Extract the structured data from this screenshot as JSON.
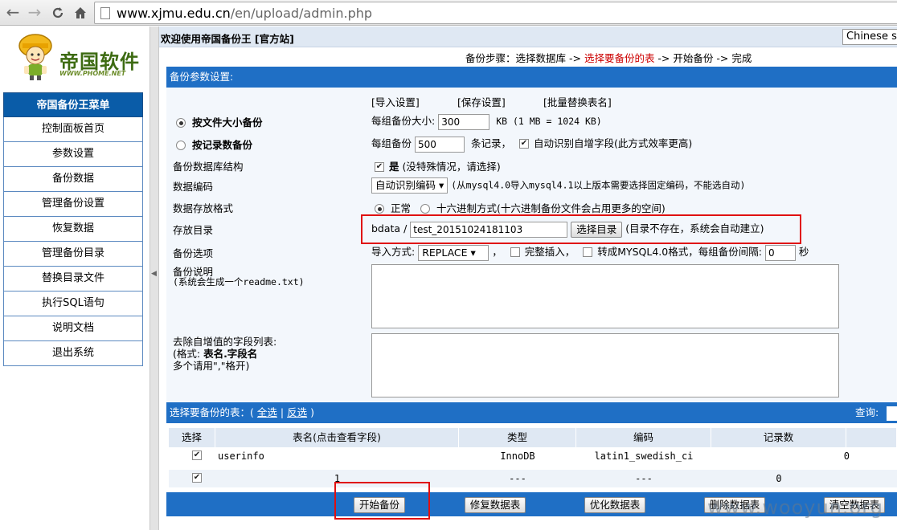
{
  "browser": {
    "url_host": "www.xjmu.edu.cn",
    "url_path": "/en/upload/admin.php"
  },
  "logo": {
    "title": "帝国软件",
    "subtitle": "WWW.PHOME.NET"
  },
  "menu": {
    "header": "帝国备份王菜单",
    "items": [
      "控制面板首页",
      "参数设置",
      "备份数据",
      "管理备份设置",
      "恢复数据",
      "管理备份目录",
      "替换目录文件",
      "执行SQL语句",
      "说明文档",
      "退出系统"
    ]
  },
  "topbar": {
    "welcome": "欢迎使用帝国备份王 [官方站]",
    "language": "Chinese si"
  },
  "steps": {
    "prefix": "备份步骤：选择数据库 -> ",
    "current": "选择要备份的表",
    "suffix": " -> 开始备份 -> 完成"
  },
  "form": {
    "title": "备份参数设置:",
    "links": [
      "[导入设置]",
      "[保存设置]",
      "[批量替换表名]"
    ],
    "by_size": {
      "label": "按文件大小备份",
      "text": "每组备份大小:",
      "value": "300",
      "unit": "KB (1 MB = 1024 KB)"
    },
    "by_records": {
      "label": "按记录数备份",
      "text": "每组备份",
      "value": "500",
      "unit": "条记录，",
      "auto_label": "自动识别自增字段(此方式效率更高)"
    },
    "structure": {
      "label": "备份数据库结构",
      "check_label": "是",
      "note": "(没特殊情况，请选择)"
    },
    "encoding": {
      "label": "数据编码",
      "value": "自动识别编码",
      "note": "(从mysql4.0导入mysql4.1以上版本需要选择固定编码，不能选自动)"
    },
    "format": {
      "label": "数据存放格式",
      "normal": "正常",
      "hex": "十六进制方式(十六进制备份文件会占用更多的空间)"
    },
    "dir": {
      "label": "存放目录",
      "prefix": "bdata /",
      "value": "test_20151024181103",
      "button": "选择目录",
      "note": "(目录不存在，系统会自动建立)"
    },
    "options": {
      "label": "备份选项",
      "import_label": "导入方式:",
      "import_value": "REPLACE",
      "comma": "，",
      "complete_insert": "完整插入，",
      "mysql40": "转成MYSQL4.0格式，",
      "interval_label": "每组备份间隔:",
      "interval_value": "0",
      "interval_unit": "秒"
    },
    "readme": {
      "label": "备份说明",
      "note": "(系统会生成一个readme.txt)"
    },
    "autoinc": {
      "label": "去除自增值的字段列表:",
      "note1_a": "(格式: ",
      "note1_b": "表名.字段名",
      "note2": "多个请用\",\"格开)"
    }
  },
  "tables": {
    "title": "选择要备份的表：(",
    "select_all": "全选",
    "sep": "|",
    "invert": "反选",
    "close": ")",
    "query_label": "查询:",
    "headers": [
      "选择",
      "表名(点击查看字段)",
      "类型",
      "编码",
      "记录数"
    ],
    "rows": [
      {
        "name": "userinfo",
        "type": "InnoDB",
        "collation": "latin1_swedish_ci",
        "records": "0"
      },
      {
        "name": "1",
        "type": "---",
        "collation": "---",
        "records": "0"
      }
    ]
  },
  "actions": [
    "开始备份",
    "修复数据表",
    "优化数据表",
    "删除数据表",
    "清空数据表"
  ],
  "watermark": "www.wooyun.org"
}
